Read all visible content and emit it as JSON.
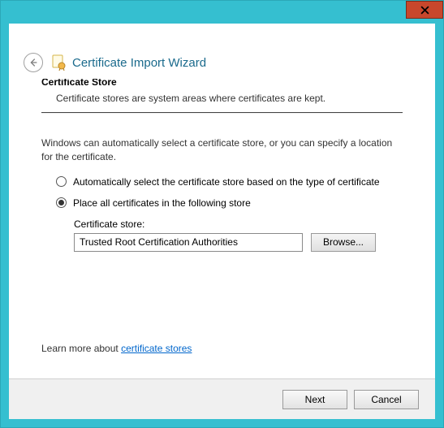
{
  "window": {
    "title": "Certificate Import Wizard"
  },
  "section": {
    "title": "Certificate Store",
    "subtitle": "Certificate stores are system areas where certificates are kept."
  },
  "description": "Windows can automatically select a certificate store, or you can specify a location for the certificate.",
  "options": {
    "auto": "Automatically select the certificate store based on the type of certificate",
    "place": "Place all certificates in the following store"
  },
  "store": {
    "label": "Certificate store:",
    "value": "Trusted Root Certification Authorities",
    "browse": "Browse..."
  },
  "learn": {
    "prefix": "Learn more about ",
    "link": "certificate stores"
  },
  "footer": {
    "next": "Next",
    "cancel": "Cancel"
  }
}
